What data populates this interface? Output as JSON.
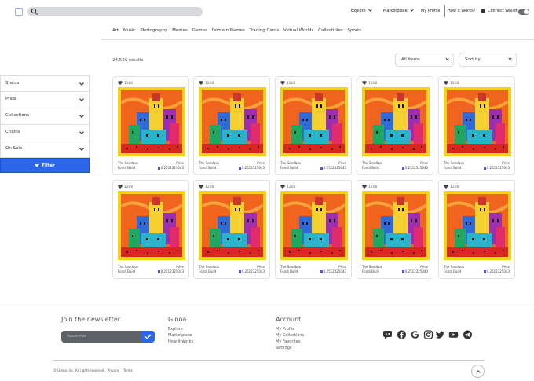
{
  "header": {
    "search_placeholder": "",
    "nav": [
      "Explore",
      "Marketplace",
      "My Profile",
      "How it Works?"
    ],
    "connect_wallet": "Connect Wallet"
  },
  "categories": [
    "Art",
    "Music",
    "Photography",
    "Memes",
    "Games",
    "Domain Names",
    "Trading Cards",
    "Virtual Worlds",
    "Collectibles",
    "Sports"
  ],
  "results": {
    "count": "24,526 results",
    "filter_dropdown": "All items",
    "sort_dropdown": "Sort by"
  },
  "filters": {
    "items": [
      "Status",
      "Price",
      "Collections",
      "Chains",
      "On Sale"
    ],
    "button": "Filter"
  },
  "cards": [
    {
      "likes": "1200",
      "name1": "The Sandbox",
      "name2": "Fondi Build",
      "price_label": "Price",
      "price": "0.2512325043"
    },
    {
      "likes": "1200",
      "name1": "The Sandbox",
      "name2": "Fondi Build",
      "price_label": "Price",
      "price": "0.2512325043"
    },
    {
      "likes": "1200",
      "name1": "The Sandbox",
      "name2": "Fondi Build",
      "price_label": "Price",
      "price": "0.2512325043"
    },
    {
      "likes": "1200",
      "name1": "The Sandbox",
      "name2": "Fondi Build",
      "price_label": "Price",
      "price": "0.2512325043"
    },
    {
      "likes": "1200",
      "name1": "The Sandbox",
      "name2": "Fondi Build",
      "price_label": "Price",
      "price": "0.2512325043"
    },
    {
      "likes": "1200",
      "name1": "The Sandbox",
      "name2": "Fondi Build",
      "price_label": "Price",
      "price": "0.2512325043"
    },
    {
      "likes": "1200",
      "name1": "The Sandbox",
      "name2": "Fondi Build",
      "price_label": "Price",
      "price": "0.2512325043"
    },
    {
      "likes": "1200",
      "name1": "The Sandbox",
      "name2": "Fondi Build",
      "price_label": "Price",
      "price": "0.2512325043"
    },
    {
      "likes": "1200",
      "name1": "The Sandbox",
      "name2": "Fondi Build",
      "price_label": "Price",
      "price": "0.2512325043"
    },
    {
      "likes": "1200",
      "name1": "The Sandbox",
      "name2": "Fondi Build",
      "price_label": "Price",
      "price": "0.2512325043"
    }
  ],
  "footer": {
    "newsletter_title": "Join the newsletter",
    "email_placeholder": "Your e-mail",
    "ginoa": {
      "title": "Ginoa",
      "links": [
        "Explore",
        "Marketplace",
        "How it works"
      ]
    },
    "account": {
      "title": "Account",
      "links": [
        "My Profile",
        "My Collections",
        "My Favorites",
        "Settings"
      ]
    },
    "social_icons": [
      "discord-icon",
      "facebook-icon",
      "google-icon",
      "instagram-icon",
      "twitter-icon",
      "youtube-icon",
      "telegram-icon"
    ],
    "copyright": "© Ginoa, Inc. All rights reserved.",
    "privacy": "Privacy",
    "terms": "Terms"
  },
  "colors": {
    "accent": "#2b65e8",
    "art_orange": "#f0641e",
    "art_yellow": "#f2d21a"
  }
}
